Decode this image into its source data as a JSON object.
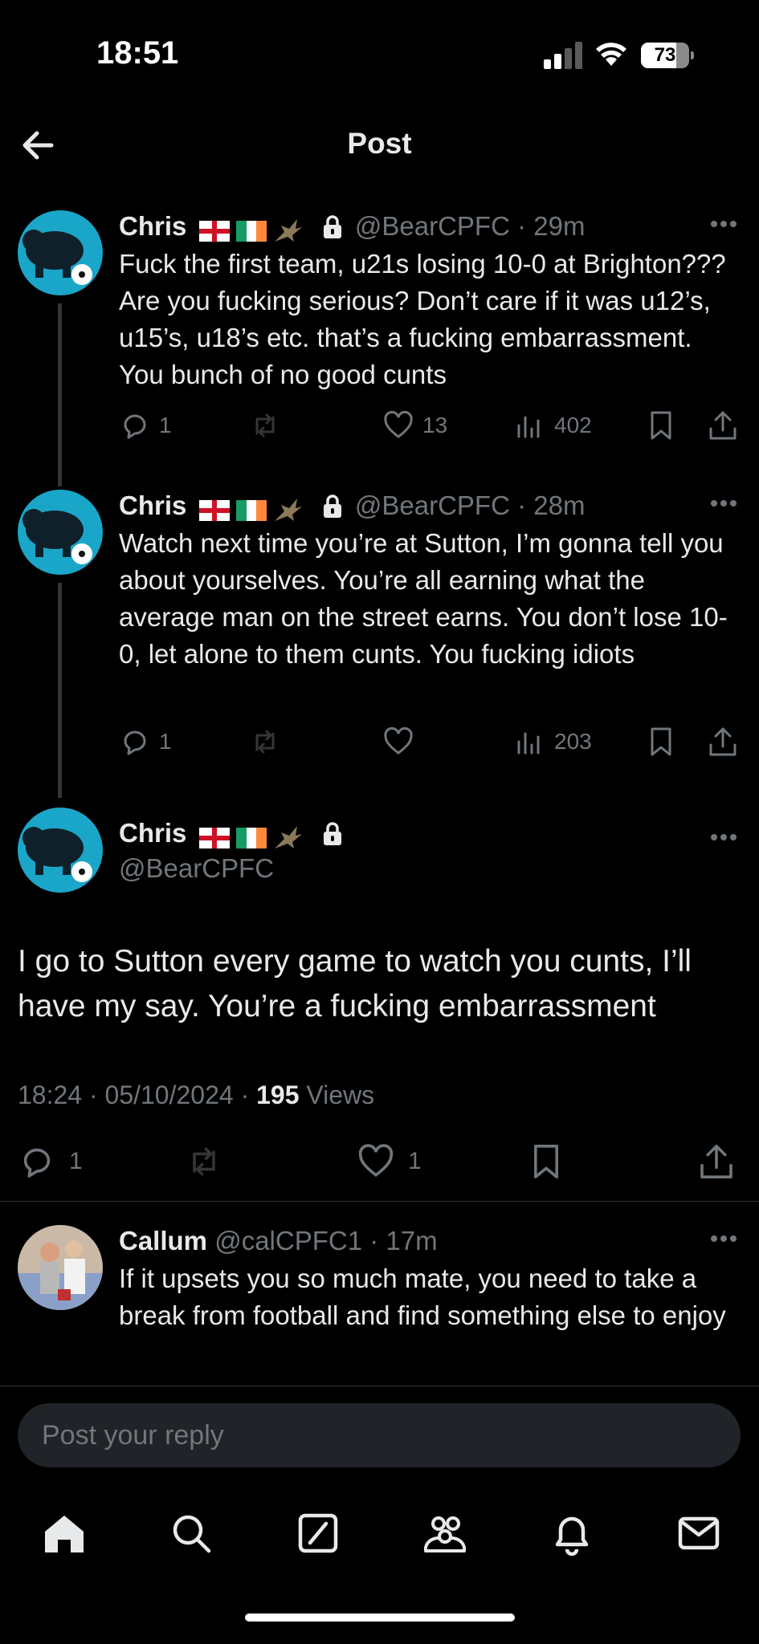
{
  "status_bar": {
    "time": "18:51",
    "battery": "73",
    "battery_level": 0.73
  },
  "header": {
    "title": "Post"
  },
  "thread": [
    {
      "name": "Chris",
      "handle": "@BearCPFC",
      "time": "29m",
      "text": "Fuck the first team, u21s losing 10-0 at Brighton??? Are you fucking serious? Don’t care if it was u12’s, u15’s, u18’s etc. that’s a fucking embarrassment. You bunch of no good cunts",
      "replies": "1",
      "reposts": "",
      "likes": "13",
      "views": "402"
    },
    {
      "name": "Chris",
      "handle": "@BearCPFC",
      "time": "28m",
      "text": "Watch next time you’re at Sutton, I’m gonna tell you about yourselves. You’re all earning what the average man on the street earns. You don’t lose 10-0, let alone to them cunts. You fucking idiots",
      "replies": "1",
      "reposts": "",
      "likes": "",
      "views": "203"
    }
  ],
  "main_post": {
    "name": "Chris",
    "handle": "@BearCPFC",
    "text": "I go to Sutton every game to watch you cunts, I’ll have my say. You’re a fucking embarrassment",
    "time": "18:24",
    "date": "05/10/2024",
    "views_count": "195",
    "views_label": "Views",
    "replies": "1",
    "likes": "1"
  },
  "reply": {
    "name": "Callum",
    "handle": "@calCPFC1",
    "time": "17m",
    "text": "If it upsets you so much mate, you need to take a break from football and find something else to enjoy"
  },
  "reply_bar": {
    "placeholder": "Post your reply"
  },
  "nav": [
    "home-icon",
    "search-icon",
    "grok-icon",
    "communities-icon",
    "notifications-icon",
    "messages-icon"
  ],
  "colors": {
    "background": "#000000",
    "text": "#e7e9ea",
    "muted": "#71767b",
    "avatar_blue": "#1aa6c8"
  }
}
